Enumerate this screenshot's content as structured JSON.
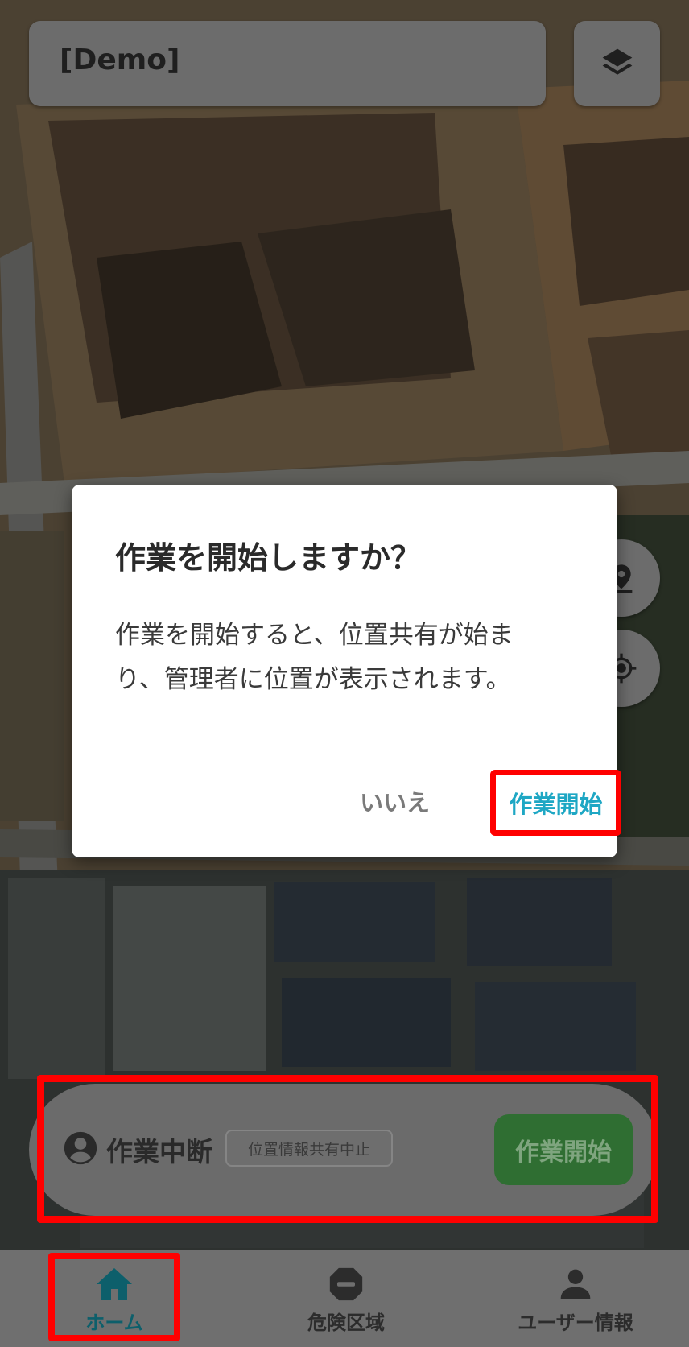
{
  "header": {
    "title": "[Demo]",
    "layers_icon": "layers-icon"
  },
  "map_controls": {
    "pin_icon": "location-pin-icon",
    "locate_icon": "my-location-icon"
  },
  "dialog": {
    "title": "作業を開始しますか？",
    "message": "作業を開始すると、位置共有が始まり、管理者に位置が表示されます。",
    "cancel_label": "いいえ",
    "confirm_label": "作業開始"
  },
  "status_bar": {
    "avatar_icon": "account-circle-icon",
    "state_label": "作業中断",
    "chip_label": "位置情報共有中止",
    "start_button_label": "作業開始"
  },
  "bottom_nav": {
    "items": [
      {
        "label": "ホーム",
        "icon": "home-icon",
        "active": true
      },
      {
        "label": "危険区域",
        "icon": "no-entry-icon",
        "active": false
      },
      {
        "label": "ユーザー情報",
        "icon": "person-icon",
        "active": false
      }
    ]
  },
  "colors": {
    "highlight": "#ff0000",
    "confirm_text": "#1ea7c4",
    "start_button": "#2f6e32",
    "nav_active": "#0d5f6b"
  }
}
